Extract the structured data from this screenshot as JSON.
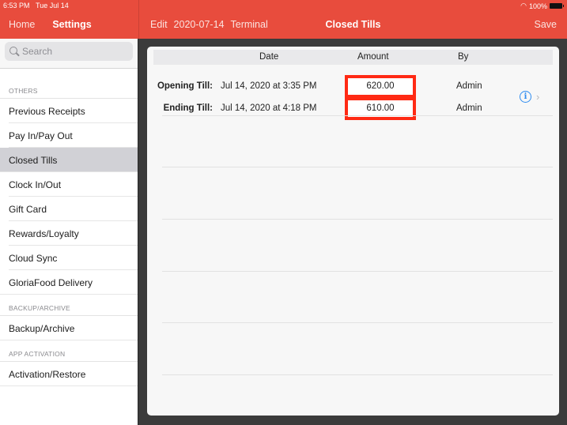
{
  "status_bar": {
    "time": "6:53 PM",
    "date": "Tue Jul 14",
    "battery": "100%"
  },
  "left_nav": {
    "home_label": "Home",
    "settings_label": "Settings"
  },
  "right_nav": {
    "edit_label": "Edit",
    "date_label": "2020-07-14",
    "terminal_label": "Terminal",
    "title": "Closed Tills",
    "save_label": "Save"
  },
  "sidebar": {
    "search_placeholder": "Search",
    "sections": [
      {
        "header": "OTHERS",
        "items": [
          "Previous Receipts",
          "Pay In/Pay Out",
          "Closed Tills",
          "Clock In/Out",
          "Gift Card",
          "Rewards/Loyalty",
          "Cloud Sync",
          "GloriaFood Delivery"
        ]
      },
      {
        "header": "BACKUP/ARCHIVE",
        "items": [
          "Backup/Archive"
        ]
      },
      {
        "header": "APP ACTIVATION",
        "items": [
          "Activation/Restore"
        ]
      }
    ],
    "selected": "Closed Tills"
  },
  "table": {
    "columns": [
      "Date",
      "Amount",
      "By"
    ],
    "rows": [
      {
        "label": "Opening Till:",
        "date": "Jul 14, 2020 at 3:35 PM",
        "amount": "620.00",
        "by": "Admin"
      },
      {
        "label": "Ending Till:",
        "date": "Jul 14, 2020 at 4:18 PM",
        "amount": "610.00",
        "by": "Admin"
      }
    ],
    "info_glyph": "i",
    "chevron_glyph": "›"
  },
  "colors": {
    "brand": "#e84c3d",
    "highlight": "#ff2a14",
    "info": "#2f8cf0"
  }
}
